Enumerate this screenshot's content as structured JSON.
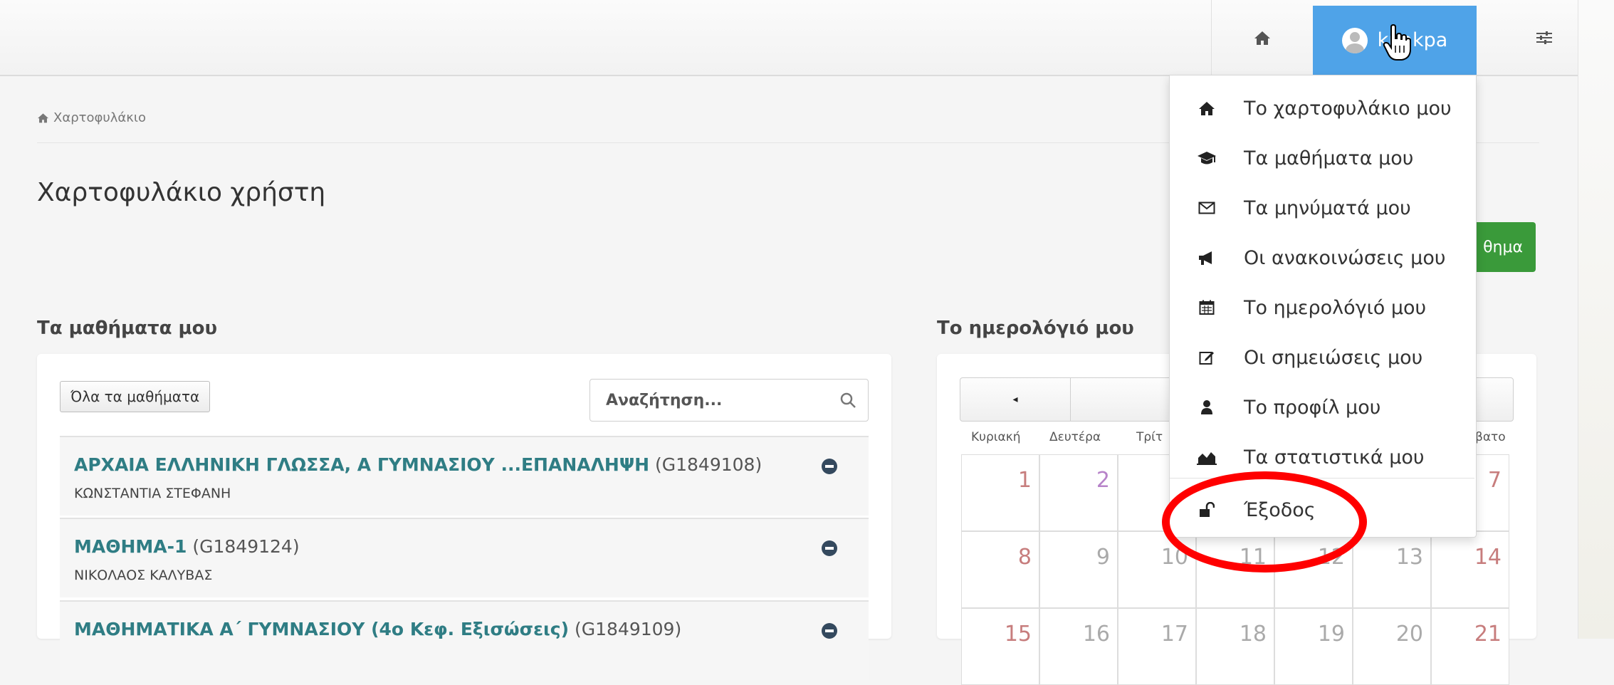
{
  "navbar": {
    "user_label": "kpakpa",
    "home_icon": "home-icon",
    "settings_icon": "sliders-icon"
  },
  "breadcrumb": {
    "label": "Χαρτοφυλάκιο"
  },
  "page": {
    "title": "Χαρτοφυλάκιο χρήστη",
    "new_course_button_partial": "θημα"
  },
  "courses_section": {
    "title": "Τα μαθήματα μου",
    "all_courses_button": "Όλα τα μαθήματα",
    "search_placeholder": "Αναζήτηση...",
    "courses": [
      {
        "title": "ΑΡΧΑΙΑ ΕΛΛΗΝΙΚΗ ΓΛΩΣΣΑ, Α ΓΥΜΝΑΣΙΟΥ ...ΕΠΑΝΑΛΗΨΗ",
        "code": "(G1849108)",
        "teacher": "ΚΩΝΣΤΑΝΤΙΑ ΣΤΕΦΑΝΗ"
      },
      {
        "title": "ΜΑΘΗΜΑ-1",
        "code": "(G1849124)",
        "teacher": "ΝΙΚΟΛΑΟΣ ΚΑΛΥΒΑΣ"
      },
      {
        "title": "ΜΑΘΗΜΑΤΙΚΑ Α΄ ΓΥΜΝΑΣΙΟΥ (4ο Κεφ. Εξισώσεις)",
        "code": "(G1849109)",
        "teacher": ""
      }
    ]
  },
  "calendar_section": {
    "title": "Το ημερολόγιό μου",
    "prev_button": "◂",
    "weekdays": [
      "Κυριακή",
      "Δευτέρα",
      "Τρίτ",
      "",
      "",
      "",
      "βατο"
    ],
    "rows": [
      [
        "1",
        "2",
        "",
        "",
        "",
        "",
        "7"
      ],
      [
        "8",
        "9",
        "10",
        "11",
        "12",
        "13",
        "14"
      ],
      [
        "15",
        "16",
        "17",
        "18",
        "19",
        "20",
        "21"
      ]
    ]
  },
  "user_menu": {
    "items": [
      {
        "label": "Το χαρτοφυλάκιο μου",
        "icon": "home-icon"
      },
      {
        "label": "Τα μαθήματα μου",
        "icon": "graduation-cap-icon"
      },
      {
        "label": "Τα μηνύματά μου",
        "icon": "envelope-icon"
      },
      {
        "label": "Οι ανακοινώσεις μου",
        "icon": "bullhorn-icon"
      },
      {
        "label": "Το ημερολόγιό μου",
        "icon": "calendar-icon"
      },
      {
        "label": "Οι σημειώσεις μου",
        "icon": "edit-icon"
      },
      {
        "label": "Το προφίλ μου",
        "icon": "user-icon"
      },
      {
        "label": "Τα στατιστικά μου",
        "icon": "area-chart-icon"
      }
    ],
    "logout": {
      "label": "Έξοδος",
      "icon": "unlock-icon"
    }
  },
  "colors": {
    "accent_blue": "#4fa3e8",
    "course_link": "#2f7d84",
    "success_green": "#3a9a3a",
    "highlight_red": "#ff0000"
  }
}
